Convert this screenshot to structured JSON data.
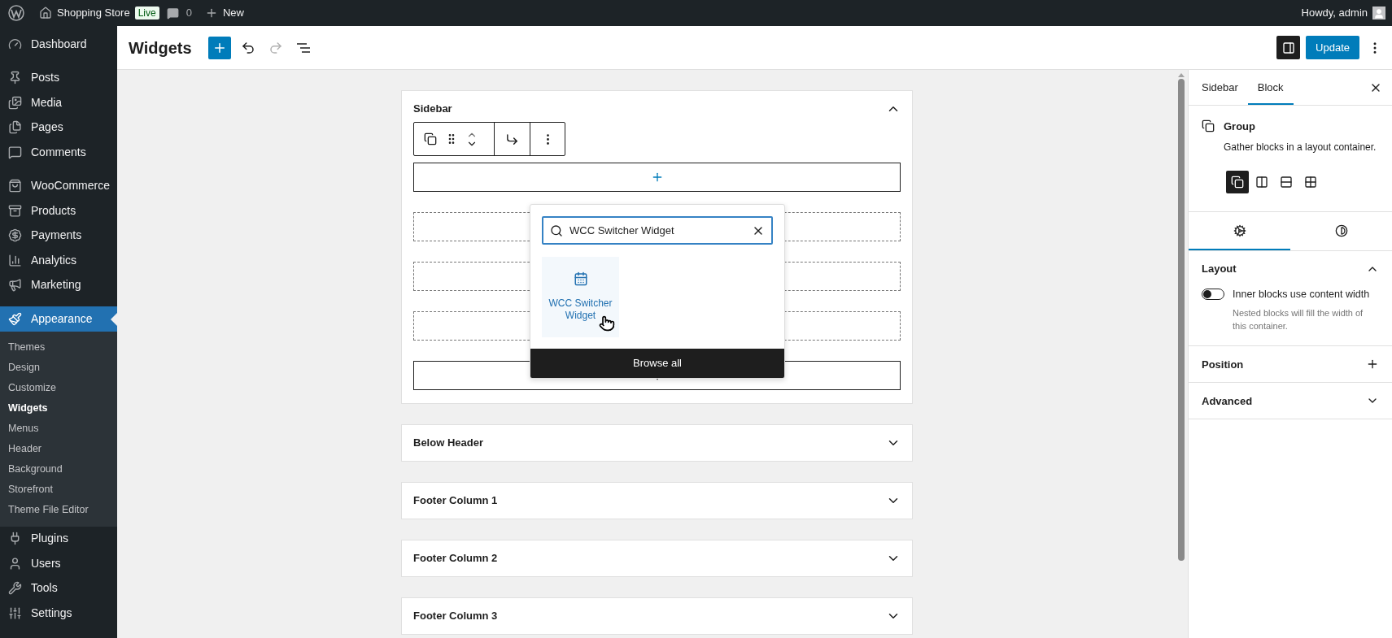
{
  "admin_bar": {
    "site_name": "Shopping Store",
    "badge": "Live",
    "comments": "0",
    "new_label": "New",
    "greeting": "Howdy, admin"
  },
  "admin_menu": [
    {
      "items": [
        {
          "label": "Dashboard",
          "selected": false
        }
      ]
    },
    {
      "items": [
        {
          "label": "Posts",
          "selected": false
        },
        {
          "label": "Media",
          "selected": false
        },
        {
          "label": "Pages",
          "selected": false
        },
        {
          "label": "Comments",
          "selected": false
        }
      ]
    },
    {
      "items": [
        {
          "label": "WooCommerce",
          "selected": false
        },
        {
          "label": "Products",
          "selected": false
        },
        {
          "label": "Payments",
          "selected": false
        },
        {
          "label": "Analytics",
          "selected": false
        },
        {
          "label": "Marketing",
          "selected": false
        }
      ]
    },
    {
      "items": [
        {
          "label": "Appearance",
          "selected": true,
          "children": [
            {
              "label": "Themes",
              "selected": false
            },
            {
              "label": "Design",
              "selected": false
            },
            {
              "label": "Customize",
              "selected": false
            },
            {
              "label": "Widgets",
              "selected": true
            },
            {
              "label": "Menus",
              "selected": false
            },
            {
              "label": "Header",
              "selected": false
            },
            {
              "label": "Background",
              "selected": false
            },
            {
              "label": "Storefront",
              "selected": false
            },
            {
              "label": "Theme File Editor",
              "selected": false
            }
          ]
        },
        {
          "label": "Plugins",
          "selected": false
        },
        {
          "label": "Users",
          "selected": false
        },
        {
          "label": "Tools",
          "selected": false
        },
        {
          "label": "Settings",
          "selected": false
        }
      ]
    }
  ],
  "header": {
    "title": "Widgets",
    "undo_disabled": false,
    "redo_disabled": true,
    "settings_pressed": true,
    "update_label": "Update"
  },
  "widget_areas": [
    {
      "title": "Sidebar",
      "expanded": true,
      "blocks": [
        {
          "kind": "appender"
        },
        {
          "kind": "placeholder"
        },
        {
          "kind": "placeholder"
        },
        {
          "kind": "placeholder"
        },
        {
          "kind": "appender"
        }
      ]
    },
    {
      "title": "Below Header",
      "expanded": false
    },
    {
      "title": "Footer Column 1",
      "expanded": false
    },
    {
      "title": "Footer Column 2",
      "expanded": false
    },
    {
      "title": "Footer Column 3",
      "expanded": false
    }
  ],
  "inserter": {
    "search_value": "WCC Switcher Widget",
    "results": [
      "WCC Switcher Widget"
    ],
    "browse_label": "Browse all"
  },
  "settings_panel": {
    "tabs": [
      {
        "label": "Sidebar",
        "selected": false
      },
      {
        "label": "Block",
        "selected": true
      }
    ],
    "block": {
      "title": "Group",
      "description": "Gather blocks in a layout container.",
      "variations": [
        {
          "selected": true
        },
        {
          "selected": false
        },
        {
          "selected": false
        },
        {
          "selected": false
        }
      ]
    },
    "inspector_tabs": [
      {
        "selected": true
      },
      {
        "selected": false
      }
    ],
    "panels": [
      {
        "kind": "collapsible",
        "title": "Layout",
        "expanded": true,
        "toggle": {
          "label": "Inner blocks use content width",
          "on": false,
          "help": "Nested blocks will fill the width of this container."
        }
      },
      {
        "kind": "addable",
        "title": "Position"
      },
      {
        "kind": "collapsible",
        "title": "Advanced",
        "expanded": false
      }
    ]
  }
}
